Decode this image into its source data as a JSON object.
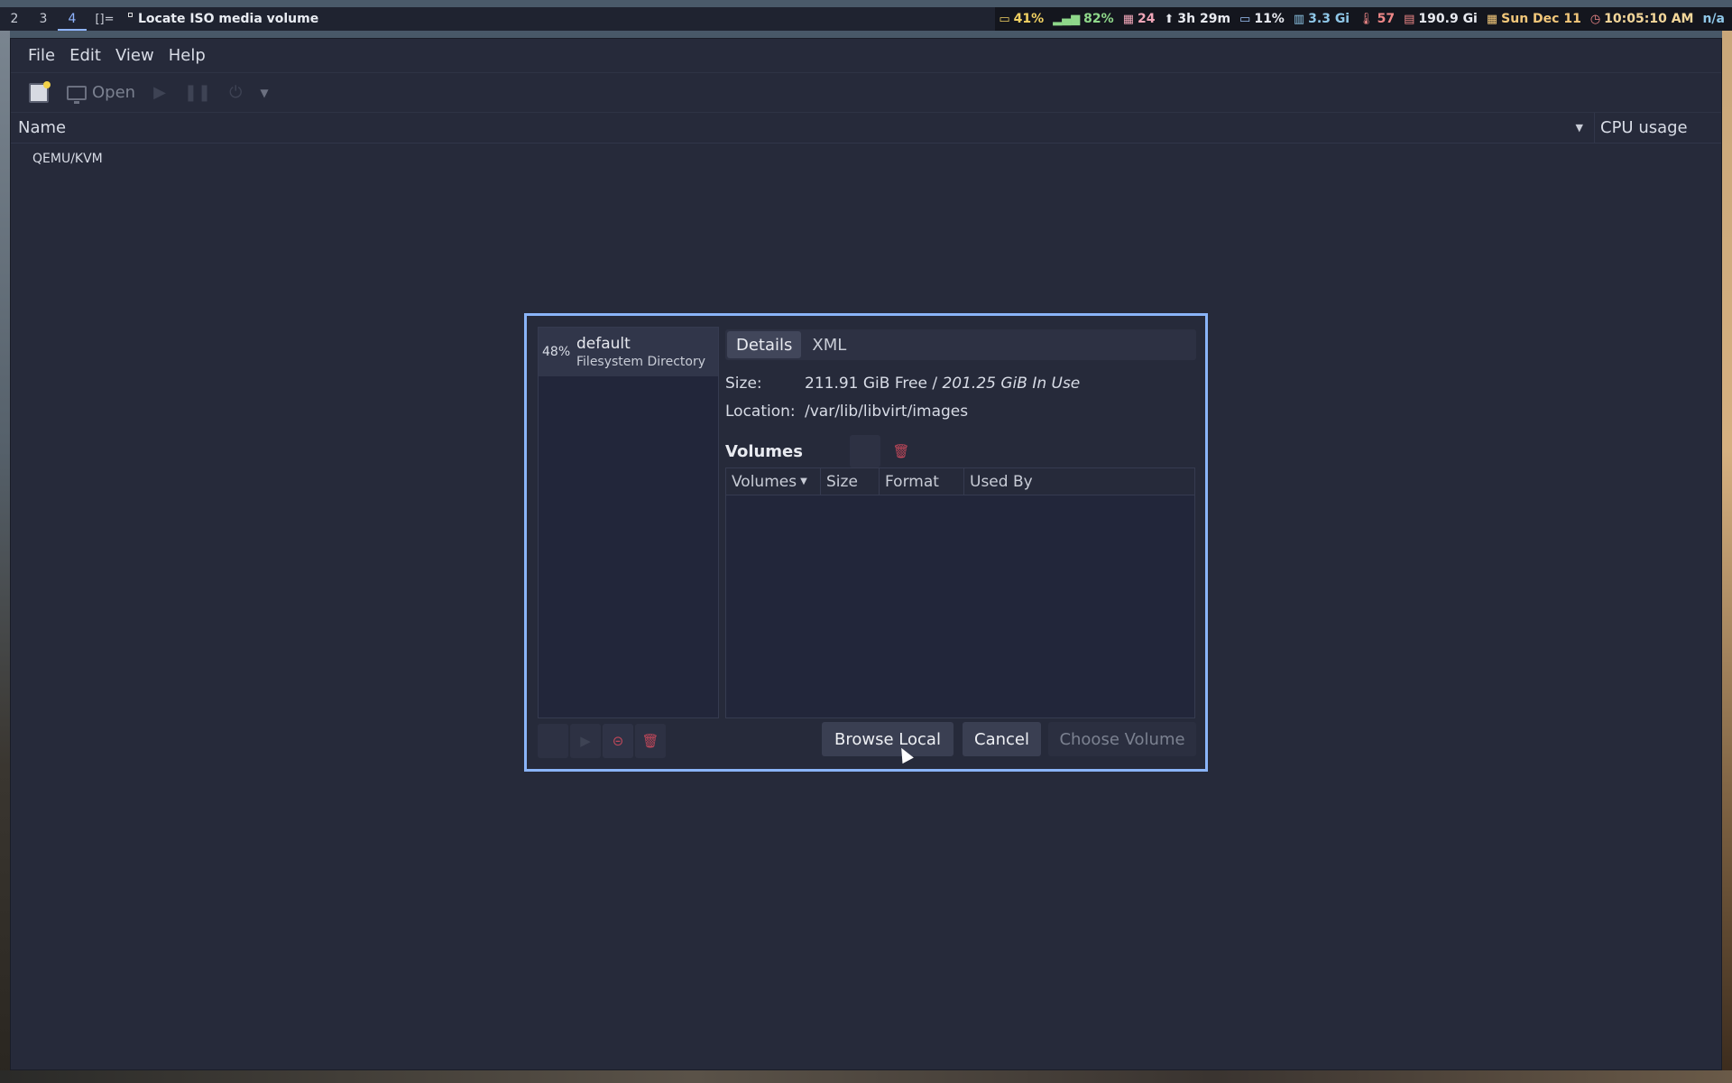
{
  "topbar": {
    "workspaces": [
      "2",
      "3",
      "4"
    ],
    "active_workspace": "4",
    "layout_indicator": "[]=",
    "window_title": "Locate ISO media volume",
    "status": {
      "battery": "41%",
      "wifi": "82%",
      "updates": "24",
      "uptime": "3h 29m",
      "cpu": "11%",
      "memory": "3.3 Gi",
      "temperature": "57",
      "disk": "190.9 Gi",
      "date": "Sun Dec 11",
      "time": "10:05:10 AM",
      "extra": "n/a"
    }
  },
  "app": {
    "menu": [
      "File",
      "Edit",
      "View",
      "Help"
    ],
    "toolbar": {
      "open_label": "Open"
    },
    "columns": {
      "name": "Name",
      "cpu": "CPU usage"
    },
    "connections": [
      "QEMU/KVM"
    ]
  },
  "dialog": {
    "pools": [
      {
        "percent": "48%",
        "name": "default",
        "type": "Filesystem Directory"
      }
    ],
    "tabs": [
      "Details",
      "XML"
    ],
    "active_tab": "Details",
    "size_label": "Size:",
    "size_free": "211.91 GiB Free / ",
    "size_used": "201.25 GiB In Use",
    "location_label": "Location:",
    "location_value": "/var/lib/libvirt/images",
    "volumes_title": "Volumes",
    "volume_columns": [
      "Volumes",
      "Size",
      "Format",
      "Used By"
    ],
    "volume_rows": [],
    "buttons": {
      "browse_local": "Browse Local",
      "cancel": "Cancel",
      "choose_volume": "Choose Volume"
    }
  },
  "colors": {
    "accent_border": "#8ab4f8",
    "window_bg": "#262a3a",
    "danger": "#c0485a"
  }
}
